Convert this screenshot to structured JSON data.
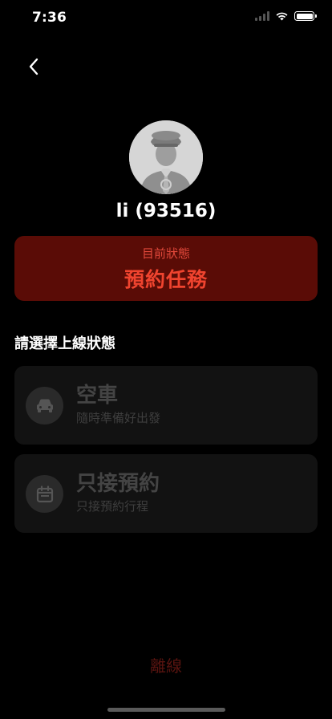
{
  "status_bar": {
    "time": "7:36",
    "icons": [
      "signal-icon",
      "wifi-icon",
      "battery-icon"
    ]
  },
  "header": {
    "back_icon": "chevron-left-icon"
  },
  "driver": {
    "name": "li (93516)",
    "avatar_icon": "driver-avatar-icon"
  },
  "current_status": {
    "label": "目前狀態",
    "value": "預約任務",
    "color": "#f0442f",
    "background": "#5a0c06"
  },
  "section": {
    "title": "請選擇上線狀態"
  },
  "options": [
    {
      "title": "空車",
      "subtitle": "隨時準備好出發",
      "icon": "car-icon"
    },
    {
      "title": "只接預約",
      "subtitle": "只接預約行程",
      "icon": "calendar-icon"
    }
  ],
  "footer": {
    "offline_label": "離線"
  }
}
